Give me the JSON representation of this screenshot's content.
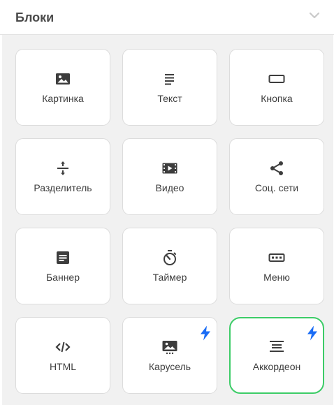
{
  "header": {
    "title": "Блоки",
    "chevron_icon": "chevron-down-icon"
  },
  "colors": {
    "selected_border": "#3ccc67",
    "bolt": "#1a6cf5",
    "icon": "#3d3d3d",
    "panel_background": "#f1f1f1"
  },
  "blocks": [
    {
      "label": "Картинка",
      "icon": "image-icon",
      "premium": false,
      "selected": false
    },
    {
      "label": "Текст",
      "icon": "text-icon",
      "premium": false,
      "selected": false
    },
    {
      "label": "Кнопка",
      "icon": "button-icon",
      "premium": false,
      "selected": false
    },
    {
      "label": "Разделитель",
      "icon": "divider-icon",
      "premium": false,
      "selected": false
    },
    {
      "label": "Видео",
      "icon": "video-icon",
      "premium": false,
      "selected": false
    },
    {
      "label": "Соц. сети",
      "icon": "share-icon",
      "premium": false,
      "selected": false
    },
    {
      "label": "Баннер",
      "icon": "banner-icon",
      "premium": false,
      "selected": false
    },
    {
      "label": "Таймер",
      "icon": "timer-icon",
      "premium": false,
      "selected": false
    },
    {
      "label": "Меню",
      "icon": "menu-icon",
      "premium": false,
      "selected": false
    },
    {
      "label": "HTML",
      "icon": "code-icon",
      "premium": false,
      "selected": false
    },
    {
      "label": "Карусель",
      "icon": "carousel-icon",
      "premium": true,
      "selected": false
    },
    {
      "label": "Аккордеон",
      "icon": "accordion-icon",
      "premium": true,
      "selected": true
    }
  ]
}
